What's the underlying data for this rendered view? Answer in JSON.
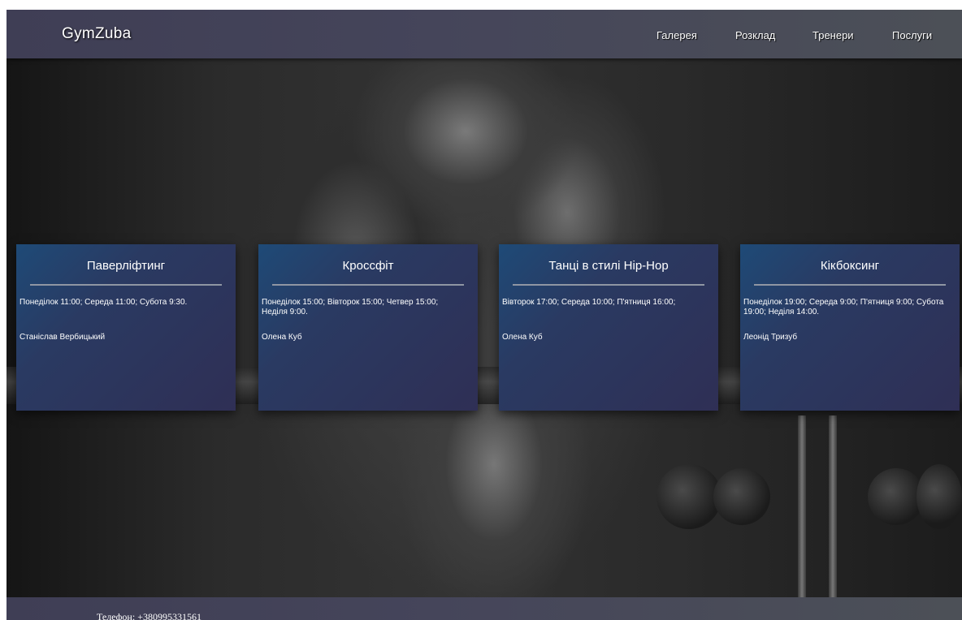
{
  "header": {
    "logo": "GymZuba",
    "nav": [
      {
        "label": "Галерея"
      },
      {
        "label": "Розклад"
      },
      {
        "label": "Тренери"
      },
      {
        "label": "Послуги"
      }
    ]
  },
  "cards": [
    {
      "title": "Паверліфтинг",
      "schedule": "Понеділок 11:00; Середа 11:00; Субота 9:30.",
      "trainer": "Станіслав Вербицький"
    },
    {
      "title": "Кроссфіт",
      "schedule": "Понеділок 15:00; Вівторок 15:00; Четвер 15:00; Неділя 9:00.",
      "trainer": "Олена Куб"
    },
    {
      "title": "Танці в стилі Hip-Hop",
      "schedule": "Вівторок 17:00; Середа 10:00; П'ятниця 16:00;",
      "trainer": "Олена Куб"
    },
    {
      "title": "Кікбоксинг",
      "schedule": "Понеділок 19:00; Середа 9:00; П'ятниця 9:00; Субота 19:00; Неділя 14:00.",
      "trainer": "Леонід Тризуб"
    }
  ],
  "footer": {
    "phone": "Телефон: +380995331561"
  },
  "colors": {
    "header_bg": "#45455a",
    "card_bg": "#2a3a62",
    "text": "#ffffff"
  }
}
